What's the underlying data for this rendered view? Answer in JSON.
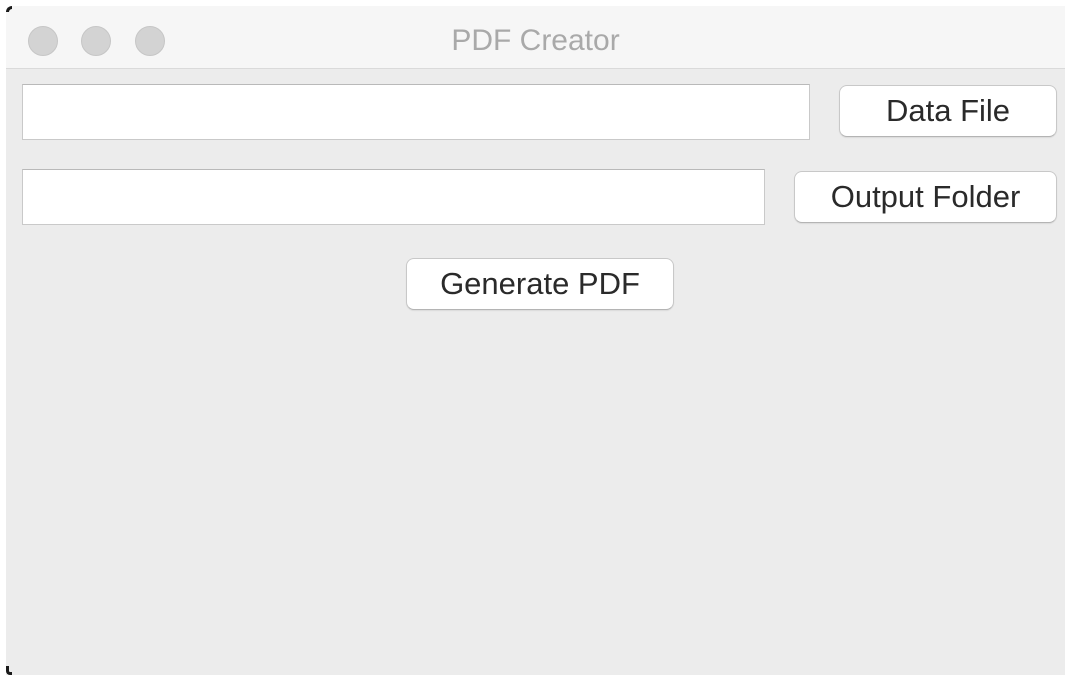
{
  "window": {
    "title": "PDF Creator"
  },
  "data_file": {
    "value": "",
    "button_label": "Data File"
  },
  "output_folder": {
    "value": "",
    "button_label": "Output Folder"
  },
  "actions": {
    "generate_label": "Generate PDF"
  }
}
